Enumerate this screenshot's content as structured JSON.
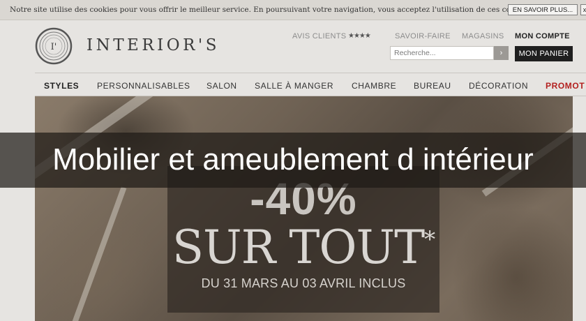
{
  "cookie_bar": {
    "text": "Notre site utilise des cookies pour vous offrir le meilleur service. En poursuivant votre navigation, vous acceptez l'utilisation de ces cookies.",
    "more_button": "EN SAVOIR PLUS...",
    "close_label": "x"
  },
  "header": {
    "logo_mark": "I'",
    "logo_text": "INTERIOR'S",
    "links": {
      "reviews": "AVIS CLIENTS",
      "stars": "★★★★",
      "star_rating": 4,
      "know_how": "SAVOIR-FAIRE",
      "stores": "MAGASINS",
      "account": "MON COMPTE"
    },
    "search": {
      "placeholder": "Recherche...",
      "button_icon": "chevron-right-icon",
      "button_label": "›"
    },
    "cart_button": "MON PANIER"
  },
  "nav": {
    "items": [
      "STYLES",
      "PERSONNALISABLES",
      "SALON",
      "SALLE À MANGER",
      "CHAMBRE",
      "BUREAU",
      "DÉCORATION",
      "PROMOT"
    ]
  },
  "hero": {
    "discount": "-40%",
    "headline": "SUR TOUT",
    "asterisk": "*",
    "dates": "DU 31 MARS AU 03 AVRIL INCLUS"
  },
  "caption": "Mobilier et ameublement d intérieur",
  "colors": {
    "promo": "#b3201f",
    "cart_bg": "#1f1f1f",
    "overlay": "#1e1a16"
  }
}
